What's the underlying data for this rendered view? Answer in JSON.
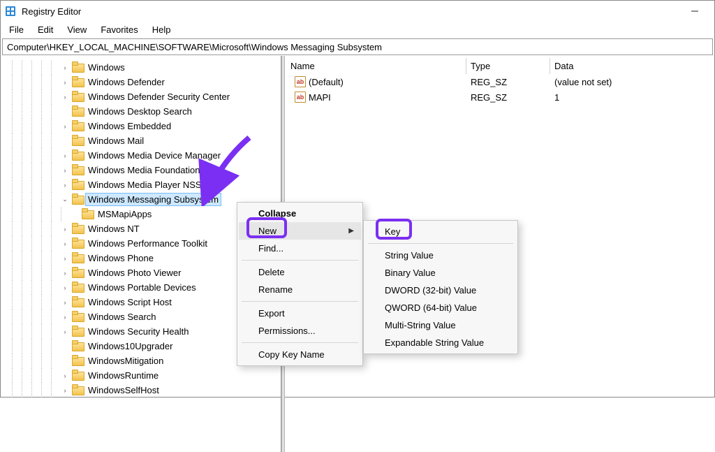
{
  "window": {
    "title": "Registry Editor"
  },
  "menubar": {
    "file": "File",
    "edit": "Edit",
    "view": "View",
    "favorites": "Favorites",
    "help": "Help"
  },
  "addressbar": {
    "path": "Computer\\HKEY_LOCAL_MACHINE\\SOFTWARE\\Microsoft\\Windows Messaging Subsystem"
  },
  "tree": {
    "items": [
      {
        "label": "Windows",
        "exp": ">",
        "sel": false
      },
      {
        "label": "Windows Defender",
        "exp": ">",
        "sel": false
      },
      {
        "label": "Windows Defender Security Center",
        "exp": ">",
        "sel": false
      },
      {
        "label": "Windows Desktop Search",
        "exp": "",
        "sel": false
      },
      {
        "label": "Windows Embedded",
        "exp": ">",
        "sel": false
      },
      {
        "label": "Windows Mail",
        "exp": "",
        "sel": false
      },
      {
        "label": "Windows Media Device Manager",
        "exp": ">",
        "sel": false
      },
      {
        "label": "Windows Media Foundation",
        "exp": ">",
        "sel": false
      },
      {
        "label": "Windows Media Player NSS",
        "exp": ">",
        "sel": false
      },
      {
        "label": "Windows Messaging Subsystem",
        "exp": "v",
        "sel": true
      },
      {
        "label": "MSMapiApps",
        "exp": "",
        "sel": false,
        "child": true
      },
      {
        "label": "Windows NT",
        "exp": ">",
        "sel": false
      },
      {
        "label": "Windows Performance Toolkit",
        "exp": ">",
        "sel": false
      },
      {
        "label": "Windows Phone",
        "exp": ">",
        "sel": false
      },
      {
        "label": "Windows Photo Viewer",
        "exp": ">",
        "sel": false
      },
      {
        "label": "Windows Portable Devices",
        "exp": ">",
        "sel": false
      },
      {
        "label": "Windows Script Host",
        "exp": ">",
        "sel": false
      },
      {
        "label": "Windows Search",
        "exp": ">",
        "sel": false
      },
      {
        "label": "Windows Security Health",
        "exp": ">",
        "sel": false
      },
      {
        "label": "Windows10Upgrader",
        "exp": "",
        "sel": false
      },
      {
        "label": "WindowsMitigation",
        "exp": "",
        "sel": false
      },
      {
        "label": "WindowsRuntime",
        "exp": ">",
        "sel": false
      },
      {
        "label": "WindowsSelfHost",
        "exp": ">",
        "sel": false
      }
    ]
  },
  "values": {
    "headers": {
      "name": "Name",
      "type": "Type",
      "data": "Data"
    },
    "rows": [
      {
        "name": "(Default)",
        "type": "REG_SZ",
        "data": "(value not set)"
      },
      {
        "name": "MAPI",
        "type": "REG_SZ",
        "data": "1"
      }
    ]
  },
  "context_menu": {
    "collapse": "Collapse",
    "new": "New",
    "find": "Find...",
    "delete": "Delete",
    "rename": "Rename",
    "export": "Export",
    "permissions": "Permissions...",
    "copy_key_name": "Copy Key Name"
  },
  "submenu_new": {
    "key": "Key",
    "string_value": "String Value",
    "binary_value": "Binary Value",
    "dword": "DWORD (32-bit) Value",
    "qword": "QWORD (64-bit) Value",
    "multi_string": "Multi-String Value",
    "expandable_string": "Expandable String Value"
  }
}
